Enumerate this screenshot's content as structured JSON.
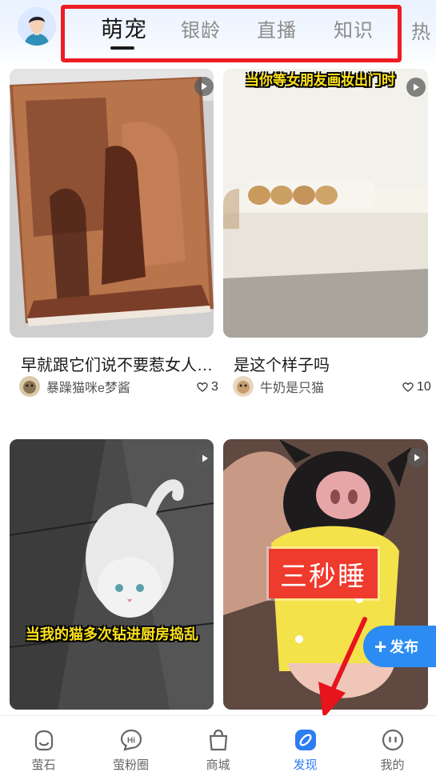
{
  "header": {
    "tabs": [
      {
        "label": "萌宠",
        "active": true
      },
      {
        "label": "银龄",
        "active": false
      },
      {
        "label": "直播",
        "active": false
      },
      {
        "label": "知识",
        "active": false
      }
    ],
    "cut_tab_label": "热"
  },
  "feed": [
    {
      "title": "早就跟它们说不要惹女人…",
      "author": "暴躁猫咪e梦酱",
      "likes": "3",
      "video": true,
      "overlay": ""
    },
    {
      "title": "是这个样子吗",
      "author": "牛奶是只猫",
      "likes": "10",
      "video": true,
      "overlay": "当你等女朋友画妆出门时"
    },
    {
      "title": "",
      "author": "",
      "likes": "",
      "video": true,
      "overlay": "当我的猫多次钻进厨房捣乱"
    },
    {
      "title": "",
      "author": "",
      "likes": "",
      "video": true,
      "overlay": "三秒睡"
    }
  ],
  "publish_button": {
    "label": "发布"
  },
  "bottom_nav": [
    {
      "label": "萤石",
      "icon": "fluorite-home-icon",
      "active": false
    },
    {
      "label": "萤粉圈",
      "icon": "hi-chat-icon",
      "active": false
    },
    {
      "label": "商城",
      "icon": "shopping-bag-icon",
      "active": false
    },
    {
      "label": "发现",
      "icon": "discover-compass-icon",
      "active": true
    },
    {
      "label": "我的",
      "icon": "profile-face-icon",
      "active": false
    }
  ],
  "colors": {
    "accent": "#2c7cf2",
    "highlight_box": "#ee1c25",
    "annotation_arrow": "#e8141c",
    "overlay_text": "#ffe31a",
    "tag_red": "#ef3a2e"
  }
}
